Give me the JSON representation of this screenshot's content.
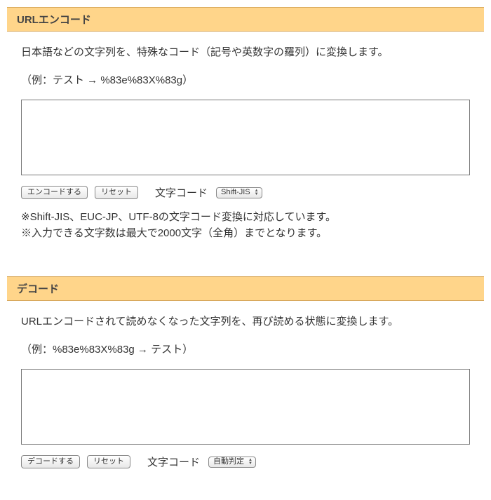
{
  "encode": {
    "header": "URLエンコード",
    "desc": "日本語などの文字列を、特殊なコード（記号や英数字の羅列）に変換します。",
    "example": "（例：テスト → %83e%83X%83g）",
    "encode_button": "エンコードする",
    "reset_button": "リセット",
    "charset_label": "文字コード",
    "charset_selected": "Shift-JIS",
    "note1": "※Shift-JIS、EUC-JP、UTF-8の文字コード変換に対応しています。",
    "note2": "※入力できる文字数は最大で2000文字（全角）までとなります。"
  },
  "decode": {
    "header": "デコード",
    "desc": "URLエンコードされて読めなくなった文字列を、再び読める状態に変換します。",
    "example": "（例：%83e%83X%83g → テスト）",
    "decode_button": "デコードする",
    "reset_button": "リセット",
    "charset_label": "文字コード",
    "charset_selected": "自動判定"
  }
}
